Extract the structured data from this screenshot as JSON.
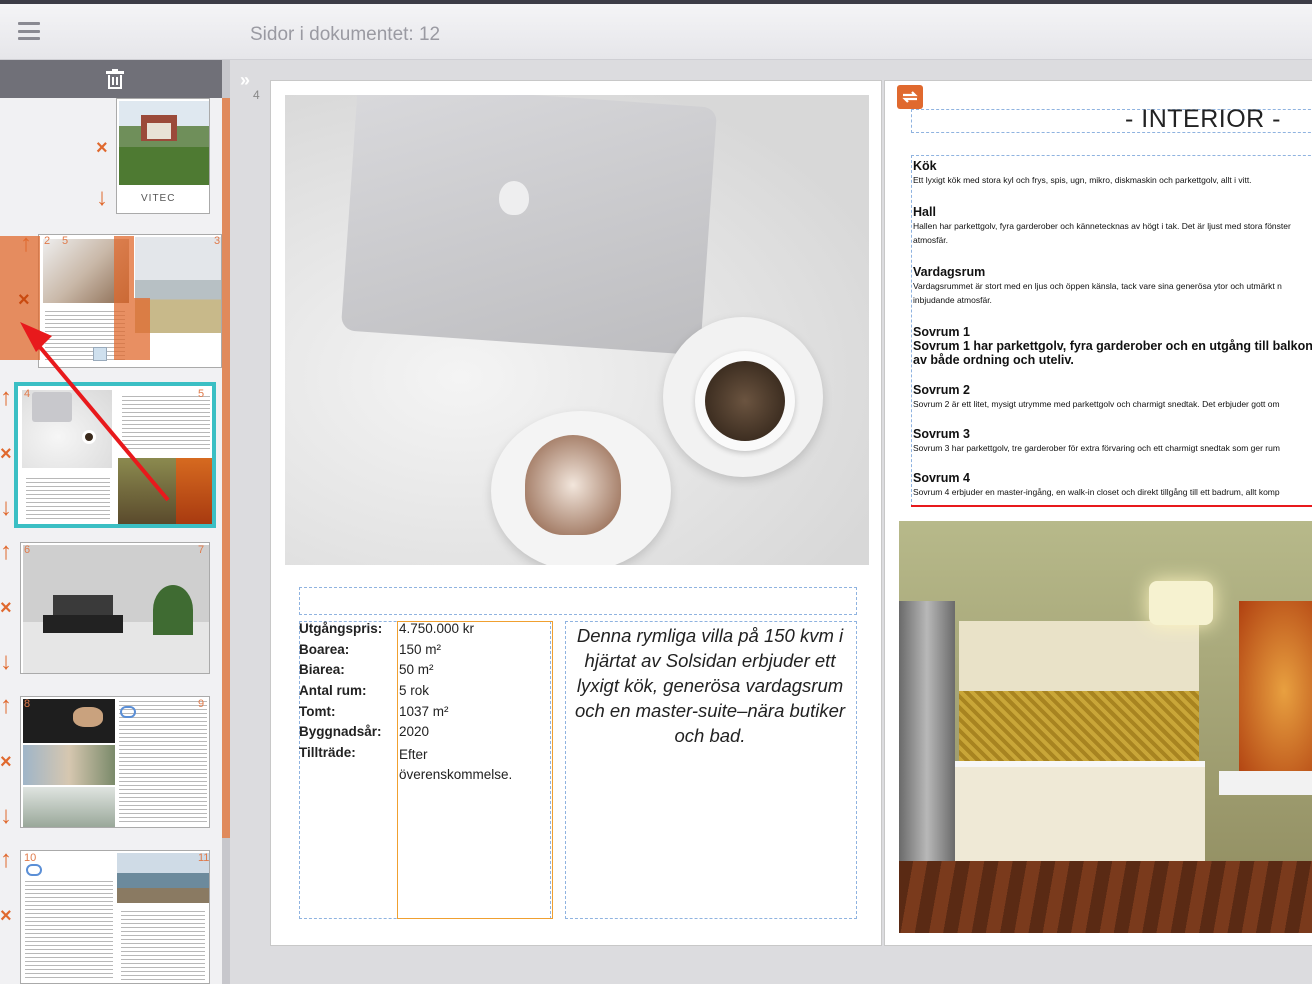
{
  "header": {
    "doc_title": "Sidor i dokumentet: 12"
  },
  "sidebar": {
    "current_page": "4",
    "page_numbers": [
      "2",
      "5",
      "3",
      "4",
      "5",
      "6",
      "7",
      "8",
      "9",
      "10",
      "11"
    ],
    "cover_brand": "VITEC"
  },
  "left_page": {
    "facts": [
      {
        "label": "Utgångspris:",
        "value": "4.750.000 kr"
      },
      {
        "label": "Boarea:",
        "value": "150 m²"
      },
      {
        "label": "Biarea:",
        "value": "50 m²"
      },
      {
        "label": "Antal rum:",
        "value": "5 rok"
      },
      {
        "label": "Tomt:",
        "value": "1037 m²"
      },
      {
        "label": "Byggnadsår:",
        "value": "2020"
      },
      {
        "label": "Tillträde:",
        "value": "Efter överenskommelse."
      }
    ],
    "blurb": "Denna rymliga villa på 150 kvm i hjärtat av Solsidan erbjuder ett lyxigt kök, generösa vardagsrum och en master-suite–nära butiker och bad."
  },
  "right_page": {
    "title": "- INTERIOR -",
    "rooms": [
      {
        "name": "Kök",
        "text": "Ett lyxigt kök med stora kyl och frys, spis, ugn, mikro, diskmaskin och parkettgolv, allt i vitt."
      },
      {
        "name": "Hall",
        "text": "Hallen har parkettgolv, fyra garderober och kännetecknas av högt i tak. Det är ljust med stora fönster",
        "text2": "atmosfär."
      },
      {
        "name": "Vardagsrum",
        "text": "Vardagsrummet är stort med en ljus och öppen känsla, tack vare sina generösa ytor och utmärkt n",
        "text2": "inbjudande atmosfär."
      },
      {
        "name": "Sovrum 1",
        "text": "Sovrum 1 har parkettgolv, fyra garderober och en utgång till balkong av både ordning och uteliv."
      },
      {
        "name": "Sovrum 2",
        "text": "Sovrum 2 är ett litet, mysigt utrymme med parkettgolv och charmigt snedtak. Det erbjuder gott om"
      },
      {
        "name": "Sovrum 3",
        "text": "Sovrum 3 har parkettgolv, tre garderober för extra förvaring och ett charmigt snedtak som ger rum"
      },
      {
        "name": "Sovrum 4",
        "text": "Sovrum 4 erbjuder en master-ingång, en walk-in closet och direkt tillgång till ett badrum, allt komp"
      }
    ]
  },
  "colors": {
    "accent": "#e0692e",
    "selection": "#3bbfc4"
  },
  "icons": [
    "hamburger-icon",
    "trash-icon",
    "collapse-icon",
    "arrow-up-icon",
    "arrow-down-icon",
    "delete-x-icon",
    "link-icon",
    "sync-icon"
  ]
}
